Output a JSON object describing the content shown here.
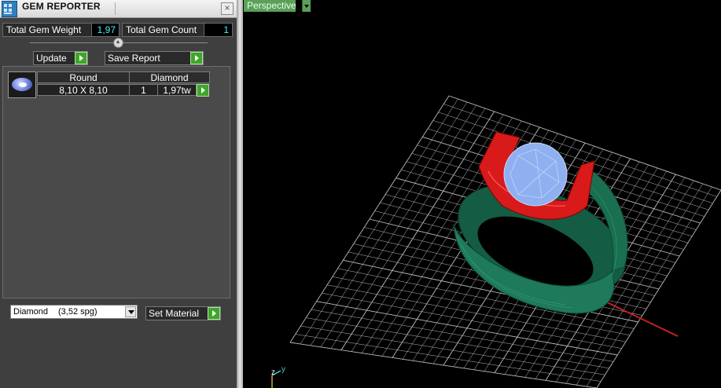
{
  "panel": {
    "title": "GEM REPORTER",
    "close_glyph": "×",
    "stats": {
      "weight_label": "Total Gem Weight",
      "weight_value": "1,97",
      "count_label": "Total Gem Count",
      "count_value": "1"
    },
    "buttons": {
      "update": "Update",
      "save_report": "Save Report",
      "set_material": "Set Material"
    },
    "gem_table": {
      "headers": [
        "Round",
        "Diamond"
      ],
      "row": {
        "size": "8,10 X 8,10",
        "count": "1",
        "weight": "1,97tw"
      }
    },
    "material_select": {
      "name": "Diamond",
      "density": "(3,52 spg)"
    }
  },
  "viewport": {
    "tab_label": "Perspective",
    "axes": {
      "z": "z",
      "y": "y"
    }
  },
  "colors": {
    "band": "#1e7a5a",
    "prongs": "#d81a1a",
    "gem": "#8fb0f0",
    "grid": "#bdbdbd",
    "value_text": "#4ff0f0",
    "go_button": "#3fa52b"
  }
}
